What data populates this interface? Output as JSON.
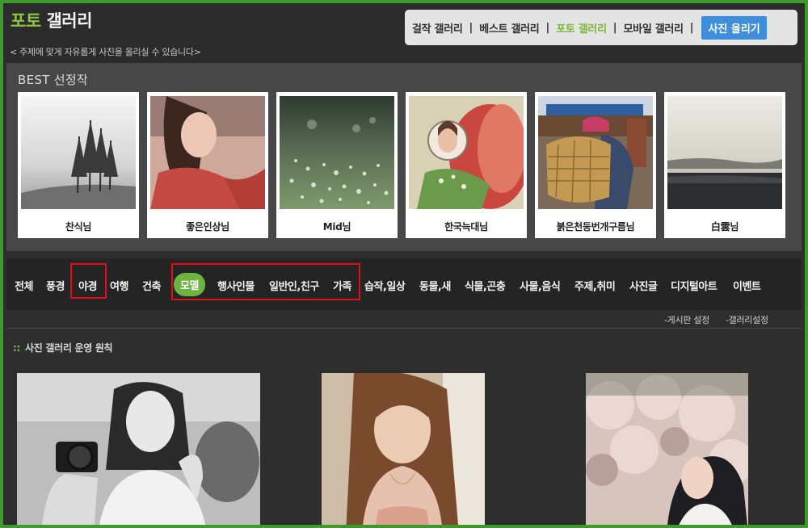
{
  "header": {
    "title_accent": "포토",
    "title_main": "갤러리",
    "subtitle": "< 주제에 맞게 자유롭게 사진을 올리실 수 있습니다>"
  },
  "topnav": {
    "items": [
      "걸작 갤러리",
      "베스트 갤러리",
      "포토 갤러리",
      "모바일 갤러리"
    ],
    "separator": "|",
    "active_index": 2,
    "upload_label": "사진 올리기"
  },
  "best": {
    "title": "BEST 선정작",
    "items": [
      {
        "caption": "찬식님"
      },
      {
        "caption": "좋은인상님"
      },
      {
        "caption": "Mid님"
      },
      {
        "caption": "한국늑대님"
      },
      {
        "caption": "붉은천둥번개구름님"
      },
      {
        "caption": "白雲님"
      }
    ]
  },
  "categories": {
    "items": [
      "전체",
      "풍경",
      "야경",
      "여행",
      "건축",
      "모델",
      "행사인물",
      "일반인,친구",
      "가족",
      "습작,일상",
      "동물,새",
      "식물,곤충",
      "사물,음식",
      "주제,취미",
      "사진글",
      "디지털아트",
      "이벤트"
    ],
    "selected": "모델"
  },
  "settings": {
    "board": "-게시판 설정",
    "gallery": "-갤러리설정"
  },
  "rules": {
    "dots": "::",
    "label": "사진 갤러리 운영 원칙"
  },
  "colors": {
    "frame_border": "#3e9a2a",
    "accent_green": "#8cc63f",
    "upload_blue": "#3f8edb",
    "highlight_red": "#e01010"
  }
}
